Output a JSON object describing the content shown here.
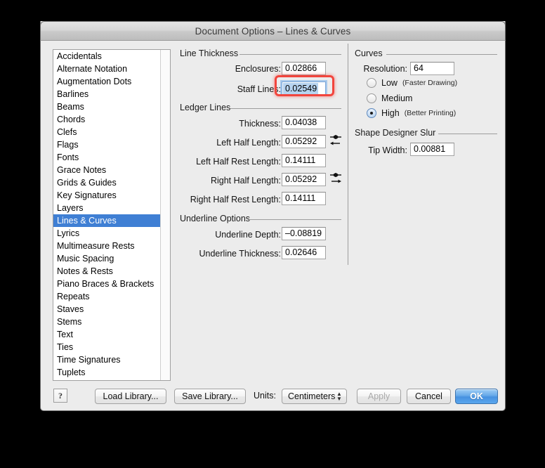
{
  "window": {
    "title": "Document Options – Lines & Curves"
  },
  "sidebar": {
    "items": [
      {
        "label": "Accidentals",
        "selected": false
      },
      {
        "label": "Alternate Notation",
        "selected": false
      },
      {
        "label": "Augmentation Dots",
        "selected": false
      },
      {
        "label": "Barlines",
        "selected": false
      },
      {
        "label": "Beams",
        "selected": false
      },
      {
        "label": "Chords",
        "selected": false
      },
      {
        "label": "Clefs",
        "selected": false
      },
      {
        "label": "Flags",
        "selected": false
      },
      {
        "label": "Fonts",
        "selected": false
      },
      {
        "label": "Grace Notes",
        "selected": false
      },
      {
        "label": "Grids & Guides",
        "selected": false
      },
      {
        "label": "Key Signatures",
        "selected": false
      },
      {
        "label": "Layers",
        "selected": false
      },
      {
        "label": "Lines & Curves",
        "selected": true
      },
      {
        "label": "Lyrics",
        "selected": false
      },
      {
        "label": "Multimeasure Rests",
        "selected": false
      },
      {
        "label": "Music Spacing",
        "selected": false
      },
      {
        "label": "Notes & Rests",
        "selected": false
      },
      {
        "label": "Piano Braces & Brackets",
        "selected": false
      },
      {
        "label": "Repeats",
        "selected": false
      },
      {
        "label": "Staves",
        "selected": false
      },
      {
        "label": "Stems",
        "selected": false
      },
      {
        "label": "Text",
        "selected": false
      },
      {
        "label": "Ties",
        "selected": false
      },
      {
        "label": "Time Signatures",
        "selected": false
      },
      {
        "label": "Tuplets",
        "selected": false
      }
    ]
  },
  "line_thickness": {
    "group_label": "Line Thickness",
    "enclosures_label": "Enclosures:",
    "enclosures_value": "0.02866",
    "staff_lines_label": "Staff Lines:",
    "staff_lines_value": "0.02549",
    "staff_lines_highlighted": true
  },
  "ledger_lines": {
    "group_label": "Ledger Lines",
    "thickness_label": "Thickness:",
    "thickness_value": "0.04038",
    "left_half_length_label": "Left Half Length:",
    "left_half_length_value": "0.05292",
    "left_half_rest_length_label": "Left Half Rest Length:",
    "left_half_rest_length_value": "0.14111",
    "right_half_length_label": "Right Half Length:",
    "right_half_length_value": "0.05292",
    "right_half_rest_length_label": "Right Half Rest Length:",
    "right_half_rest_length_value": "0.14111"
  },
  "underline_options": {
    "group_label": "Underline Options",
    "depth_label": "Underline Depth:",
    "depth_value": "–0.08819",
    "thickness_label": "Underline Thickness:",
    "thickness_value": "0.02646"
  },
  "curves": {
    "group_label": "Curves",
    "resolution_label": "Resolution:",
    "resolution_value": "64",
    "options": [
      {
        "label": "Low",
        "note": "(Faster Drawing)",
        "selected": false
      },
      {
        "label": "Medium",
        "note": "",
        "selected": false
      },
      {
        "label": "High",
        "note": "(Better Printing)",
        "selected": true
      }
    ]
  },
  "shape_designer_slur": {
    "group_label": "Shape Designer Slur",
    "tip_width_label": "Tip Width:",
    "tip_width_value": "0.00881"
  },
  "footer": {
    "help_label": "?",
    "load_library_label": "Load Library...",
    "save_library_label": "Save Library...",
    "units_label": "Units:",
    "units_value": "Centimeters",
    "apply_label": "Apply",
    "apply_enabled": false,
    "cancel_label": "Cancel",
    "ok_label": "OK"
  },
  "colors": {
    "selection_blue": "#3f7fd4",
    "highlight_red": "#f2453d",
    "focus_ring": "#a8c9ec",
    "text_selection": "#b6d3f0",
    "window_bg": "#ececec",
    "primary_button": "#4691e0"
  }
}
